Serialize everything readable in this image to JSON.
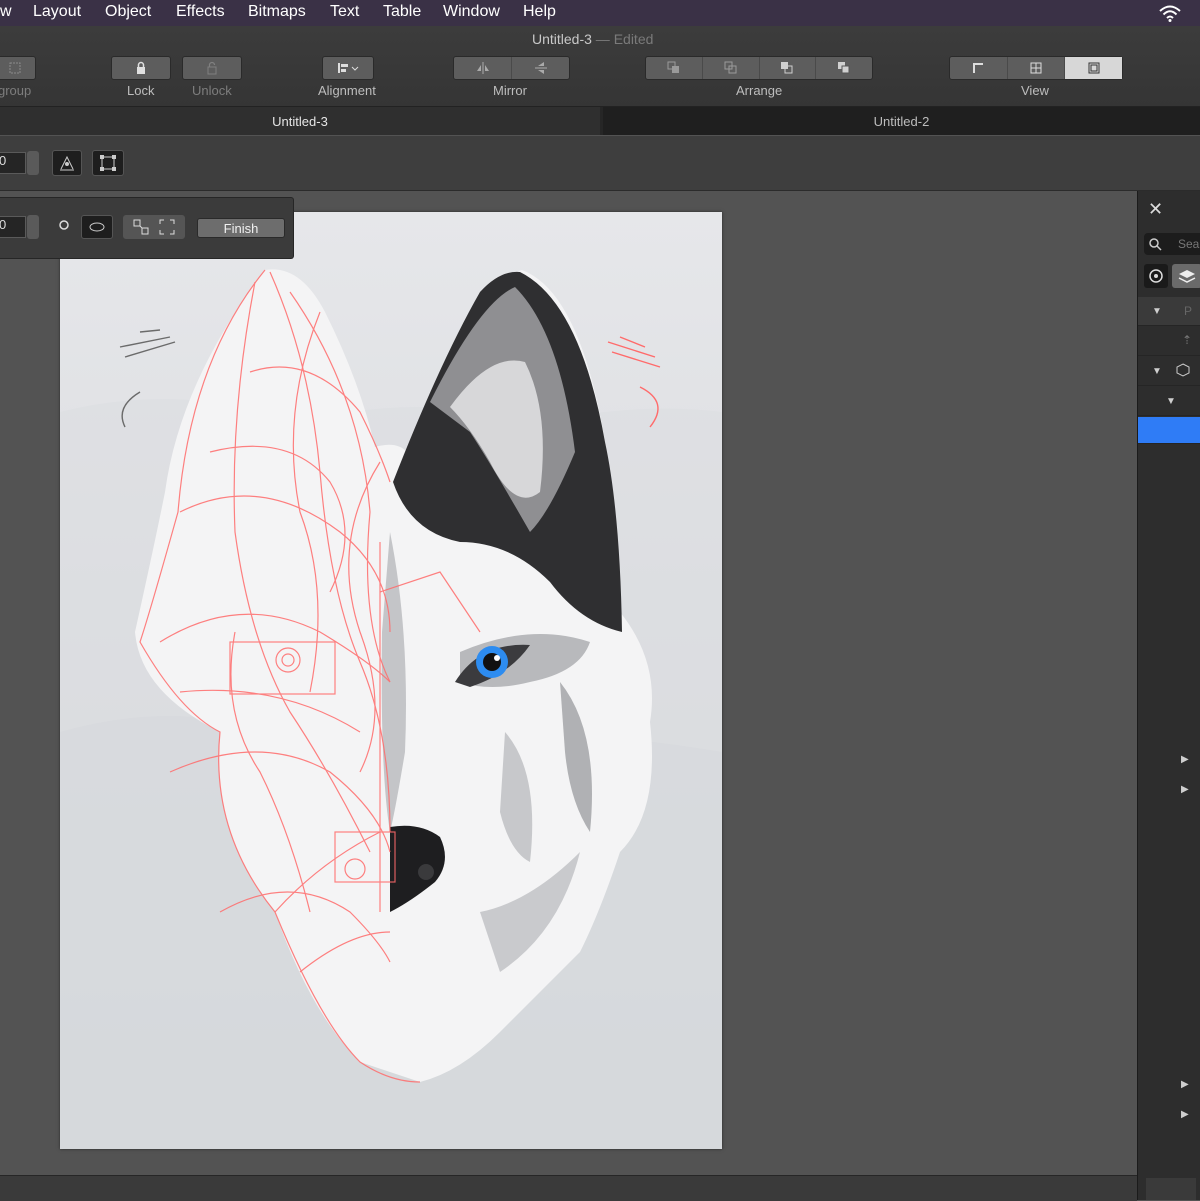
{
  "menu": [
    "w",
    "Layout",
    "Object",
    "Effects",
    "Bitmaps",
    "Text",
    "Table",
    "Window",
    "Help"
  ],
  "window": {
    "title": "Untitled-3",
    "edited": " — Edited"
  },
  "toolbar": {
    "ungroup": "group",
    "lock": "Lock",
    "unlock": "Unlock",
    "alignment": "Alignment",
    "mirror": "Mirror",
    "arrange": "Arrange",
    "view": "View"
  },
  "tabs": {
    "active": "Untitled-3",
    "inactive": "Untitled-2"
  },
  "context": {
    "value1": "0",
    "value2": "0",
    "finish": "Finish"
  },
  "panel": {
    "search_placeholder": "Sea",
    "layer_label": "P"
  },
  "colors": {
    "accent": "#2f7cf6",
    "eye": "#2d8cf0",
    "sketch": "#ff6b6b"
  },
  "artwork": {
    "subject": "wolf illustration, half sketch half vector"
  }
}
